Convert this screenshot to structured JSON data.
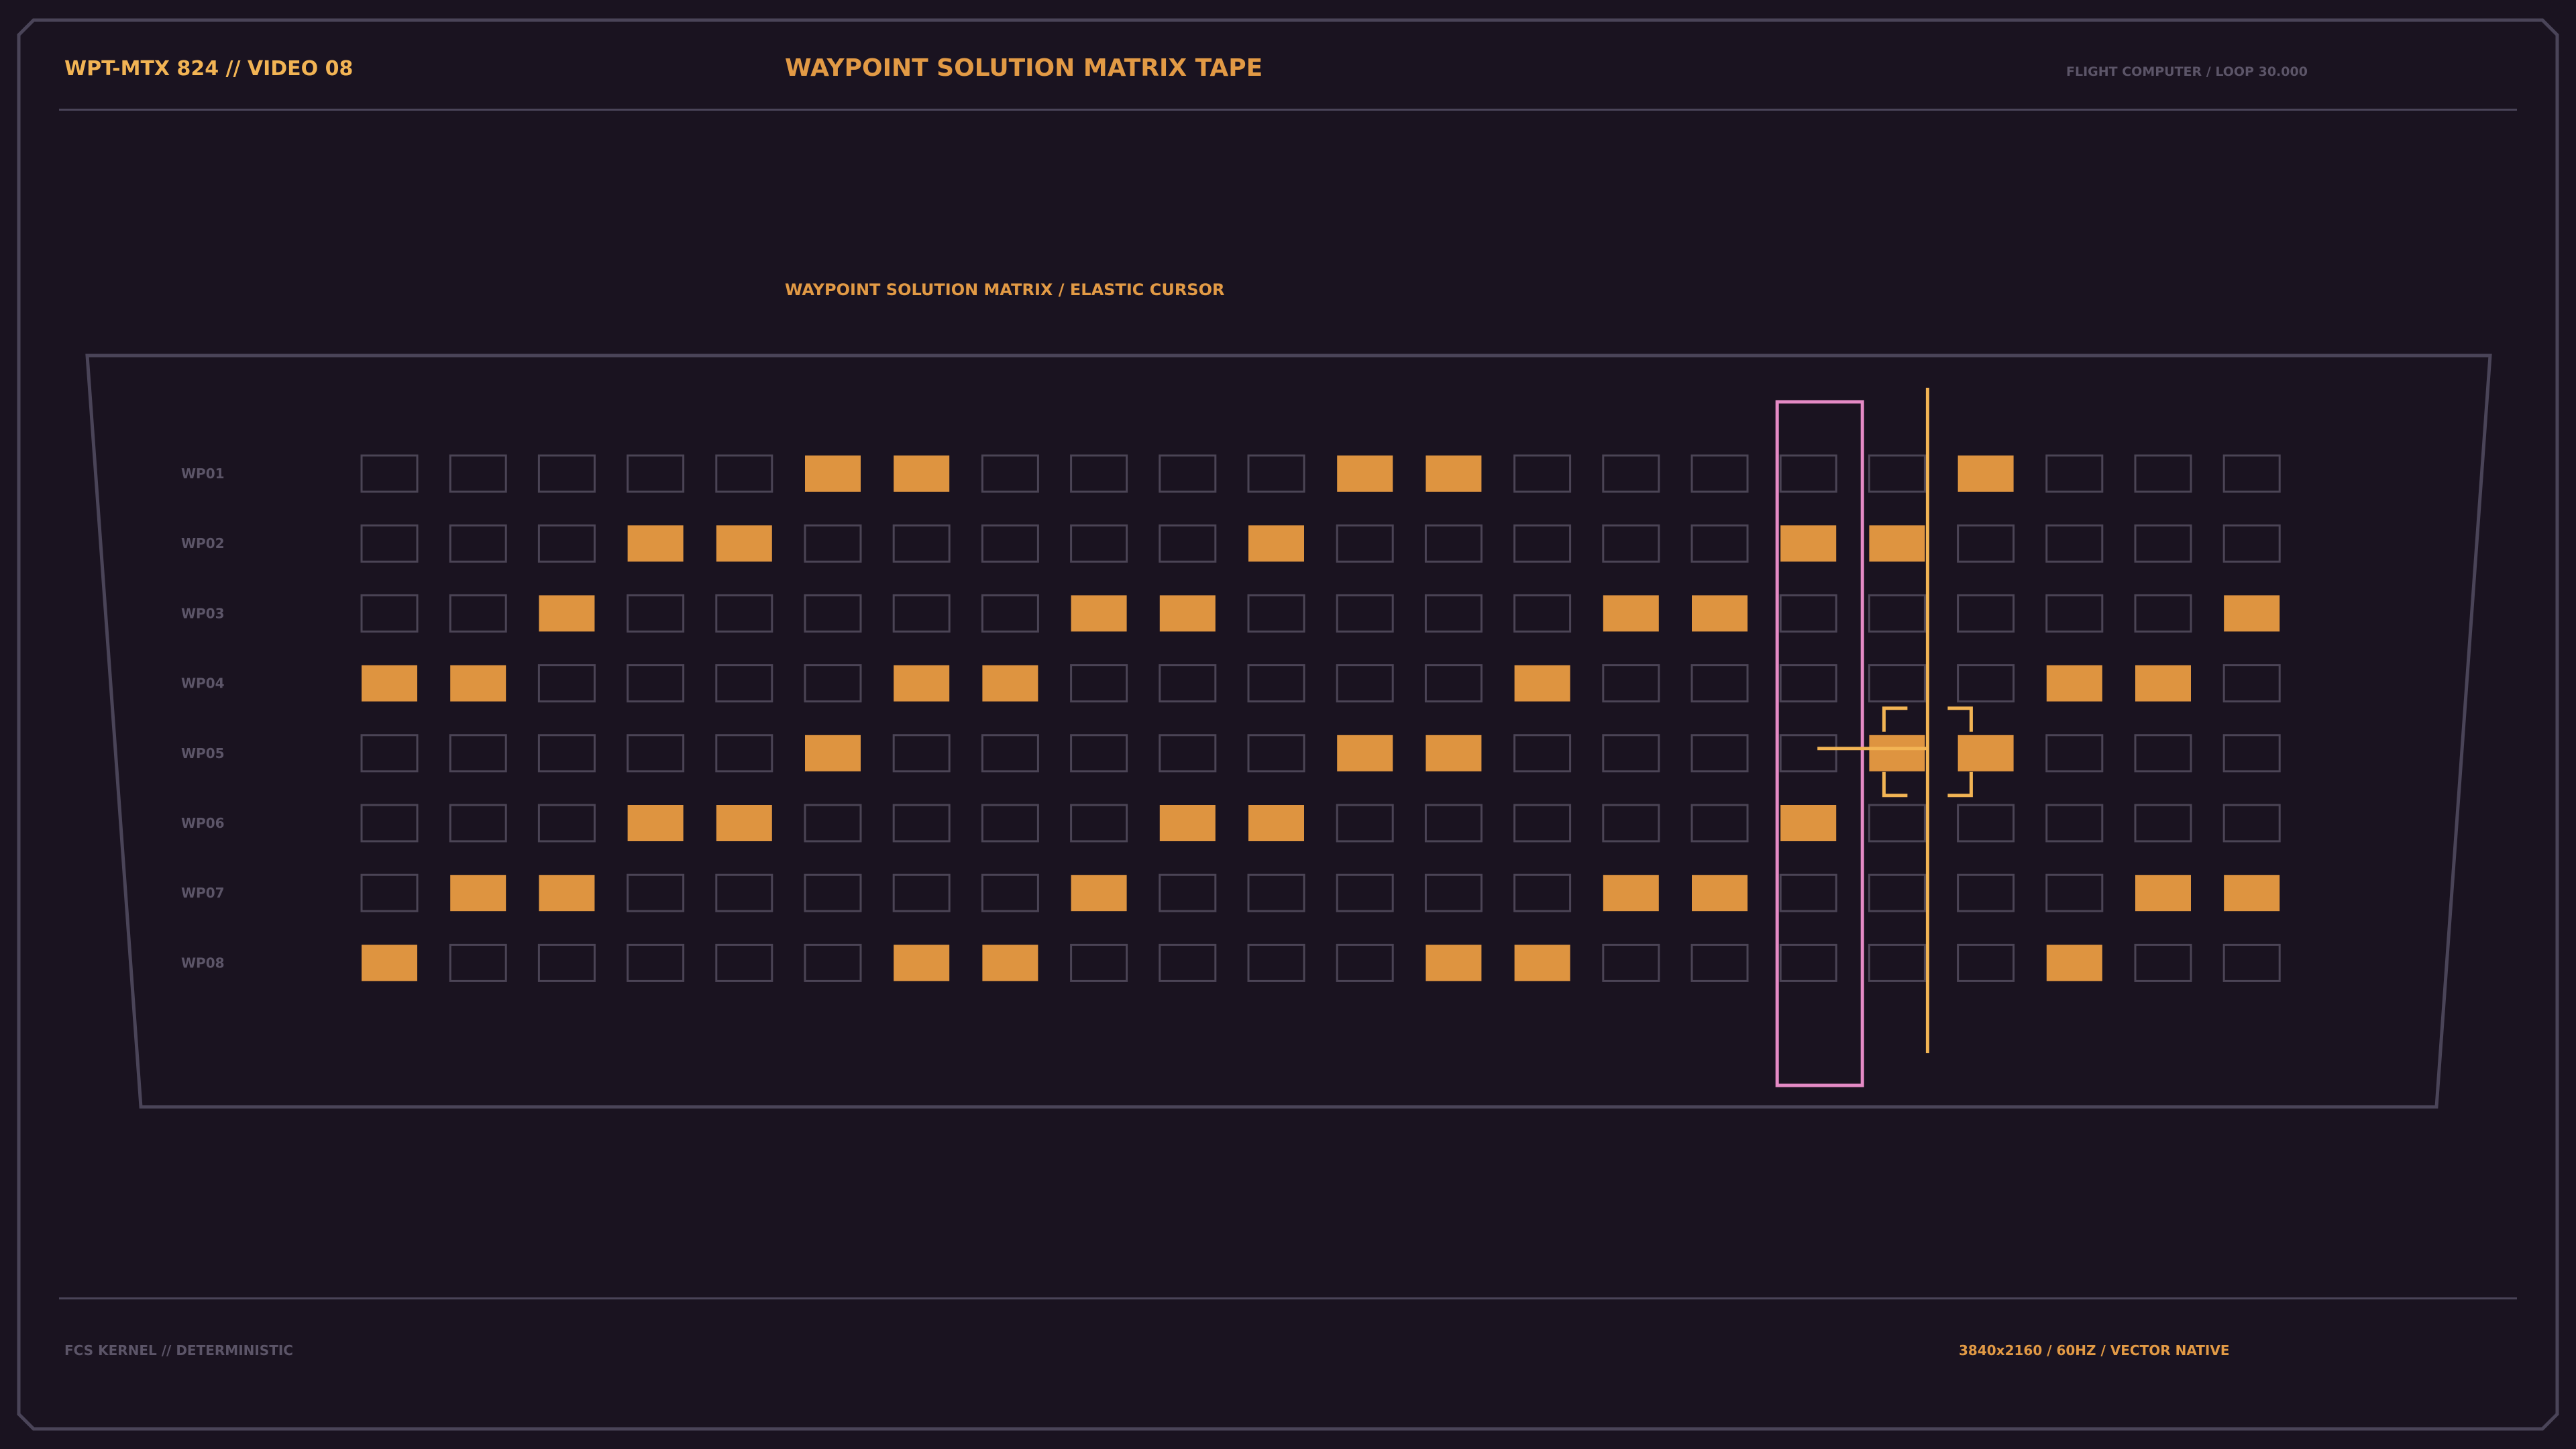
{
  "header": {
    "left_label": "WPT-MTX 824 // VIDEO 08",
    "title": "WAYPOINT SOLUTION MATRIX TAPE",
    "right_label": "FLIGHT COMPUTER / LOOP 30.000"
  },
  "panel": {
    "title": "WAYPOINT SOLUTION MATRIX / ELASTIC CURSOR"
  },
  "footer": {
    "left_label": "FCS KERNEL // DETERMINISTIC",
    "right_label": "3840x2160 / 60HZ / VECTOR NATIVE"
  },
  "colors": {
    "background": "#1a1320",
    "frame_stroke": "#4a4458",
    "cell_empty_stroke": "#4b4455",
    "cell_active": "#de9440",
    "header_accent": "#f2b454",
    "title_accent": "#e29a45",
    "muted_text": "#5c5568",
    "cursor_band": "#e58ac5",
    "cursor_line": "#f2b454"
  },
  "matrix": {
    "columns": 22,
    "rows": [
      {
        "label": "WP01",
        "active": [
          5,
          6,
          11,
          12,
          18
        ]
      },
      {
        "label": "WP02",
        "active": [
          3,
          4,
          10,
          16,
          17
        ]
      },
      {
        "label": "WP03",
        "active": [
          2,
          8,
          9,
          14,
          15,
          21
        ]
      },
      {
        "label": "WP04",
        "active": [
          0,
          1,
          6,
          7,
          13,
          19,
          20
        ]
      },
      {
        "label": "WP05",
        "active": [
          5,
          11,
          12,
          17,
          18
        ]
      },
      {
        "label": "WP06",
        "active": [
          3,
          4,
          9,
          10,
          16
        ]
      },
      {
        "label": "WP07",
        "active": [
          1,
          2,
          8,
          14,
          15,
          20,
          21
        ]
      },
      {
        "label": "WP08",
        "active": [
          0,
          6,
          7,
          12,
          13,
          19
        ]
      }
    ],
    "cursor": {
      "band_column": 16,
      "line_column": 17,
      "target_row": 4,
      "target_column": 17
    }
  }
}
